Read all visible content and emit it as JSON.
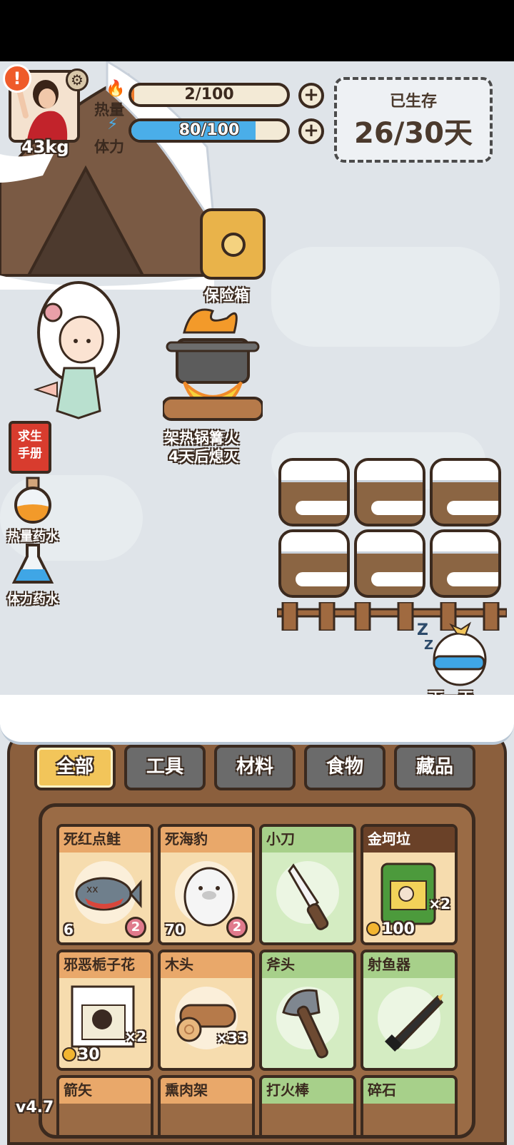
{
  "player": {
    "weight": "43kg",
    "heat_label": "热量",
    "heat_value": "2/100",
    "heat_fraction": 0.02,
    "stamina_label": "体力",
    "stamina_value": "80/100",
    "stamina_fraction": 0.8
  },
  "survival": {
    "title": "已生存",
    "days": "26/30天"
  },
  "world": {
    "safe_label": "保险箱",
    "fire_label": "架热锅篝火",
    "fire_status": "4天后熄灭",
    "next_day_label": "下一天"
  },
  "side": {
    "manual_label": "求生手册",
    "manual_line1": "求生",
    "manual_line2": "手册",
    "heat_potion": "热量药水",
    "stamina_potion": "体力药水"
  },
  "tabs": [
    "全部",
    "工具",
    "材料",
    "食物",
    "藏品"
  ],
  "active_tab": "全部",
  "inventory": [
    {
      "name": "死红点鲑",
      "type": "food",
      "heat": "6",
      "spoil": "2"
    },
    {
      "name": "死海豹",
      "type": "food",
      "heat": "70",
      "spoil": "2"
    },
    {
      "name": "小刀",
      "type": "tool"
    },
    {
      "name": "金坷垃",
      "type": "rare",
      "count": "×2",
      "price": "100"
    },
    {
      "name": "邪恶栀子花",
      "type": "food",
      "count": "×2",
      "price": "30"
    },
    {
      "name": "木头",
      "type": "food",
      "count": "×33"
    },
    {
      "name": "斧头",
      "type": "tool"
    },
    {
      "name": "射鱼器",
      "type": "tool"
    },
    {
      "name": "箭矢",
      "type": "food"
    },
    {
      "name": "熏肉架",
      "type": "food"
    },
    {
      "name": "打火棒",
      "type": "tool"
    },
    {
      "name": "碎石",
      "type": "tool"
    }
  ],
  "version": "v4.7",
  "colors": {
    "outline": "#3b2a1f",
    "stamina_bar": "#4aaee9",
    "tab_active": "#f2c55a",
    "tab_inactive": "#6b6b6b",
    "alert": "#ef5b2a"
  }
}
